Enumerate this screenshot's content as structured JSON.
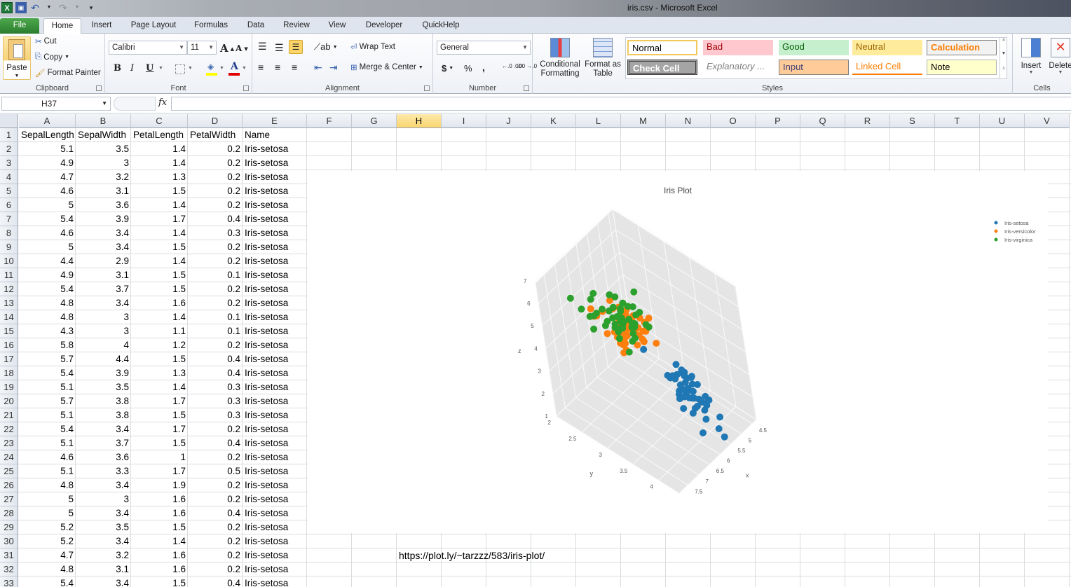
{
  "window": {
    "title": "iris.csv  -  Microsoft Excel"
  },
  "quick_access": {
    "icons": [
      "excel-logo-icon",
      "save-icon",
      "undo-icon",
      "redo-icon",
      "customize-qat-icon"
    ]
  },
  "tabs": [
    {
      "label": "File",
      "active": false
    },
    {
      "label": "Home",
      "active": true
    },
    {
      "label": "Insert",
      "active": false
    },
    {
      "label": "Page Layout",
      "active": false
    },
    {
      "label": "Formulas",
      "active": false
    },
    {
      "label": "Data",
      "active": false
    },
    {
      "label": "Review",
      "active": false
    },
    {
      "label": "View",
      "active": false
    },
    {
      "label": "Developer",
      "active": false
    },
    {
      "label": "QuickHelp",
      "active": false
    }
  ],
  "ribbon": {
    "clipboard": {
      "label": "Clipboard",
      "paste": "Paste",
      "cut": "Cut",
      "copy": "Copy",
      "format_painter": "Format Painter"
    },
    "font": {
      "label": "Font",
      "font_name": "Calibri",
      "font_size": "11",
      "bold": "B",
      "italic": "I",
      "underline": "U",
      "grow": "A",
      "shrink": "A",
      "font_color": "A",
      "fill_color": "#ffff00",
      "text_color": "#e00000"
    },
    "alignment": {
      "label": "Alignment",
      "wrap_text": "Wrap Text",
      "merge_center": "Merge & Center"
    },
    "number": {
      "label": "Number",
      "format": "General",
      "currency": "$",
      "percent": "%",
      "comma": ",",
      "inc_decimal": "←.0 .00",
      "dec_decimal": ".00 →.0"
    },
    "conditional_formatting": "Conditional Formatting",
    "format_as_table": "Format as Table",
    "styles": {
      "label": "Styles",
      "items": [
        {
          "label": "Normal",
          "bg": "#ffffff",
          "fg": "#000000"
        },
        {
          "label": "Bad",
          "bg": "#ffc7ce",
          "fg": "#9c0006"
        },
        {
          "label": "Good",
          "bg": "#c6efce",
          "fg": "#006100"
        },
        {
          "label": "Neutral",
          "bg": "#ffeb9c",
          "fg": "#9c6500"
        },
        {
          "label": "Calculation",
          "bg": "#f2f2f2",
          "fg": "#fa7d00"
        },
        {
          "label": "Check Cell",
          "bg": "#a5a5a5",
          "fg": "#ffffff"
        },
        {
          "label": "Explanatory ...",
          "bg": "#ffffff",
          "fg": "#7f7f7f"
        },
        {
          "label": "Input",
          "bg": "#ffcc99",
          "fg": "#3f3f76"
        },
        {
          "label": "Linked Cell",
          "bg": "#ffffff",
          "fg": "#fa7d00"
        },
        {
          "label": "Note",
          "bg": "#ffffcc",
          "fg": "#000000"
        }
      ]
    },
    "cells": {
      "label": "Cells",
      "insert": "Insert",
      "delete": "Delete"
    }
  },
  "formula_bar": {
    "name_box": "H37",
    "fx": "fx",
    "formula": ""
  },
  "columns": [
    "A",
    "B",
    "C",
    "D",
    "E",
    "F",
    "G",
    "H",
    "I",
    "J",
    "K",
    "L",
    "M",
    "N",
    "O",
    "P",
    "Q",
    "R",
    "S",
    "T",
    "U",
    "V"
  ],
  "selected_column": "H",
  "sheet": {
    "header": [
      "SepalLength",
      "SepalWidth",
      "PetalLength",
      "PetalWidth",
      "Name"
    ],
    "rows": [
      [
        "5.1",
        "3.5",
        "1.4",
        "0.2",
        "Iris-setosa"
      ],
      [
        "4.9",
        "3",
        "1.4",
        "0.2",
        "Iris-setosa"
      ],
      [
        "4.7",
        "3.2",
        "1.3",
        "0.2",
        "Iris-setosa"
      ],
      [
        "4.6",
        "3.1",
        "1.5",
        "0.2",
        "Iris-setosa"
      ],
      [
        "5",
        "3.6",
        "1.4",
        "0.2",
        "Iris-setosa"
      ],
      [
        "5.4",
        "3.9",
        "1.7",
        "0.4",
        "Iris-setosa"
      ],
      [
        "4.6",
        "3.4",
        "1.4",
        "0.3",
        "Iris-setosa"
      ],
      [
        "5",
        "3.4",
        "1.5",
        "0.2",
        "Iris-setosa"
      ],
      [
        "4.4",
        "2.9",
        "1.4",
        "0.2",
        "Iris-setosa"
      ],
      [
        "4.9",
        "3.1",
        "1.5",
        "0.1",
        "Iris-setosa"
      ],
      [
        "5.4",
        "3.7",
        "1.5",
        "0.2",
        "Iris-setosa"
      ],
      [
        "4.8",
        "3.4",
        "1.6",
        "0.2",
        "Iris-setosa"
      ],
      [
        "4.8",
        "3",
        "1.4",
        "0.1",
        "Iris-setosa"
      ],
      [
        "4.3",
        "3",
        "1.1",
        "0.1",
        "Iris-setosa"
      ],
      [
        "5.8",
        "4",
        "1.2",
        "0.2",
        "Iris-setosa"
      ],
      [
        "5.7",
        "4.4",
        "1.5",
        "0.4",
        "Iris-setosa"
      ],
      [
        "5.4",
        "3.9",
        "1.3",
        "0.4",
        "Iris-setosa"
      ],
      [
        "5.1",
        "3.5",
        "1.4",
        "0.3",
        "Iris-setosa"
      ],
      [
        "5.7",
        "3.8",
        "1.7",
        "0.3",
        "Iris-setosa"
      ],
      [
        "5.1",
        "3.8",
        "1.5",
        "0.3",
        "Iris-setosa"
      ],
      [
        "5.4",
        "3.4",
        "1.7",
        "0.2",
        "Iris-setosa"
      ],
      [
        "5.1",
        "3.7",
        "1.5",
        "0.4",
        "Iris-setosa"
      ],
      [
        "4.6",
        "3.6",
        "1",
        "0.2",
        "Iris-setosa"
      ],
      [
        "5.1",
        "3.3",
        "1.7",
        "0.5",
        "Iris-setosa"
      ],
      [
        "4.8",
        "3.4",
        "1.9",
        "0.2",
        "Iris-setosa"
      ],
      [
        "5",
        "3",
        "1.6",
        "0.2",
        "Iris-setosa"
      ],
      [
        "5",
        "3.4",
        "1.6",
        "0.4",
        "Iris-setosa"
      ],
      [
        "5.2",
        "3.5",
        "1.5",
        "0.2",
        "Iris-setosa"
      ],
      [
        "5.2",
        "3.4",
        "1.4",
        "0.2",
        "Iris-setosa"
      ],
      [
        "4.7",
        "3.2",
        "1.6",
        "0.2",
        "Iris-setosa"
      ],
      [
        "4.8",
        "3.1",
        "1.6",
        "0.2",
        "Iris-setosa"
      ],
      [
        "5.4",
        "3.4",
        "1.5",
        "0.4",
        "Iris-setosa"
      ]
    ],
    "url_cell": "https://plot.ly/~tarzzz/583/iris-plot/"
  },
  "chart_data": {
    "type": "scatter",
    "subtype": "scatter3d",
    "title": "Iris Plot",
    "xlabel": "x",
    "ylabel": "y",
    "zlabel": "z",
    "x_ticks": [
      "4.5",
      "5",
      "5.5",
      "6",
      "6.5",
      "7",
      "7.5"
    ],
    "y_ticks": [
      "2",
      "2.5",
      "3",
      "3.5",
      "4"
    ],
    "z_ticks": [
      "1",
      "2",
      "3",
      "4",
      "5",
      "6",
      "7"
    ],
    "xlim": [
      4.3,
      7.9
    ],
    "ylim": [
      2.0,
      4.4
    ],
    "zlim": [
      1.0,
      6.9
    ],
    "legend": "top-right",
    "series": [
      {
        "name": "Iris-setosa",
        "color": "#1f77b4",
        "points": [
          [
            5.1,
            3.5,
            1.4
          ],
          [
            4.9,
            3,
            1.4
          ],
          [
            4.7,
            3.2,
            1.3
          ],
          [
            4.6,
            3.1,
            1.5
          ],
          [
            5,
            3.6,
            1.4
          ],
          [
            5.4,
            3.9,
            1.7
          ],
          [
            4.6,
            3.4,
            1.4
          ],
          [
            5,
            3.4,
            1.5
          ],
          [
            4.4,
            2.9,
            1.4
          ],
          [
            4.9,
            3.1,
            1.5
          ],
          [
            5.4,
            3.7,
            1.5
          ],
          [
            4.8,
            3.4,
            1.6
          ],
          [
            4.8,
            3,
            1.4
          ],
          [
            4.3,
            3,
            1.1
          ],
          [
            5.8,
            4,
            1.2
          ],
          [
            5.7,
            4.4,
            1.5
          ],
          [
            5.4,
            3.9,
            1.3
          ],
          [
            5.1,
            3.5,
            1.4
          ],
          [
            5.7,
            3.8,
            1.7
          ],
          [
            5.1,
            3.8,
            1.5
          ],
          [
            5.4,
            3.4,
            1.7
          ],
          [
            5.1,
            3.7,
            1.5
          ],
          [
            4.6,
            3.6,
            1
          ],
          [
            5.1,
            3.3,
            1.7
          ],
          [
            4.8,
            3.4,
            1.9
          ],
          [
            5,
            3,
            1.6
          ],
          [
            5,
            3.4,
            1.6
          ],
          [
            5.2,
            3.5,
            1.5
          ],
          [
            5.2,
            3.4,
            1.4
          ],
          [
            4.7,
            3.2,
            1.6
          ],
          [
            4.8,
            3.1,
            1.6
          ],
          [
            5.4,
            3.4,
            1.5
          ],
          [
            5.2,
            4.1,
            1.5
          ],
          [
            5.5,
            4.2,
            1.4
          ],
          [
            4.9,
            3.1,
            1.5
          ],
          [
            5,
            3.2,
            1.2
          ],
          [
            5.5,
            3.5,
            1.3
          ],
          [
            4.4,
            3,
            1.3
          ],
          [
            5.1,
            3.4,
            1.5
          ],
          [
            5,
            3.5,
            1.3
          ],
          [
            4.5,
            2.3,
            1.3
          ],
          [
            4.4,
            3.2,
            1.3
          ],
          [
            5,
            3.5,
            1.6
          ],
          [
            5.1,
            3.8,
            1.9
          ],
          [
            4.8,
            3,
            1.4
          ],
          [
            5.1,
            3.8,
            1.6
          ],
          [
            4.6,
            3.2,
            1.4
          ],
          [
            5.3,
            3.7,
            1.5
          ],
          [
            5,
            3.3,
            1.4
          ]
        ]
      },
      {
        "name": "Iris-versicolor",
        "color": "#ff7f0e",
        "points": [
          [
            7,
            3.2,
            4.7
          ],
          [
            6.4,
            3.2,
            4.5
          ],
          [
            6.9,
            3.1,
            4.9
          ],
          [
            5.5,
            2.3,
            4
          ],
          [
            6.5,
            2.8,
            4.6
          ],
          [
            5.7,
            2.8,
            4.5
          ],
          [
            6.3,
            3.3,
            4.7
          ],
          [
            4.9,
            2.4,
            3.3
          ],
          [
            6.6,
            2.9,
            4.6
          ],
          [
            5.2,
            2.7,
            3.9
          ],
          [
            5,
            2,
            3.5
          ],
          [
            5.9,
            3,
            4.2
          ],
          [
            6,
            2.2,
            4
          ],
          [
            6.1,
            2.9,
            4.7
          ],
          [
            5.6,
            2.9,
            3.6
          ],
          [
            6.7,
            3.1,
            4.4
          ],
          [
            5.6,
            3,
            4.5
          ],
          [
            5.8,
            2.7,
            4.1
          ],
          [
            6.2,
            2.2,
            4.5
          ],
          [
            5.6,
            2.5,
            3.9
          ],
          [
            5.9,
            3.2,
            4.8
          ],
          [
            6.1,
            2.8,
            4
          ],
          [
            6.3,
            2.5,
            4.9
          ],
          [
            6.1,
            2.8,
            4.7
          ],
          [
            6.4,
            2.9,
            4.3
          ],
          [
            6.6,
            3,
            4.4
          ],
          [
            6.8,
            2.8,
            4.8
          ],
          [
            6.7,
            3,
            5
          ],
          [
            6,
            2.9,
            4.5
          ],
          [
            5.7,
            2.6,
            3.5
          ],
          [
            5.5,
            2.4,
            3.8
          ],
          [
            5.5,
            2.4,
            3.7
          ],
          [
            5.8,
            2.7,
            3.9
          ],
          [
            6,
            2.7,
            5.1
          ],
          [
            5.4,
            3,
            4.5
          ],
          [
            6,
            3.4,
            4.5
          ],
          [
            6.7,
            3.1,
            4.7
          ],
          [
            6.3,
            2.3,
            4.4
          ],
          [
            5.6,
            3,
            4.1
          ],
          [
            5.5,
            2.5,
            4
          ],
          [
            5.5,
            2.6,
            4.4
          ],
          [
            6.1,
            3,
            4.6
          ],
          [
            5.8,
            2.6,
            4
          ],
          [
            5,
            2.3,
            3.3
          ],
          [
            5.6,
            2.7,
            4.2
          ],
          [
            5.7,
            3,
            4.2
          ],
          [
            5.7,
            2.9,
            4.2
          ],
          [
            6.2,
            2.9,
            4.3
          ],
          [
            5.1,
            2.5,
            3
          ],
          [
            5.7,
            2.8,
            4.1
          ]
        ]
      },
      {
        "name": "Iris-virginica",
        "color": "#2ca02c",
        "points": [
          [
            6.3,
            3.3,
            6
          ],
          [
            5.8,
            2.7,
            5.1
          ],
          [
            7.1,
            3,
            5.9
          ],
          [
            6.3,
            2.9,
            5.6
          ],
          [
            6.5,
            3,
            5.8
          ],
          [
            7.6,
            3,
            6.6
          ],
          [
            4.9,
            2.5,
            4.5
          ],
          [
            7.3,
            2.9,
            6.3
          ],
          [
            6.7,
            2.5,
            5.8
          ],
          [
            7.2,
            3.6,
            6.1
          ],
          [
            6.5,
            3.2,
            5.1
          ],
          [
            6.4,
            2.7,
            5.3
          ],
          [
            6.8,
            3,
            5.5
          ],
          [
            5.7,
            2.5,
            5
          ],
          [
            5.8,
            2.8,
            5.1
          ],
          [
            6.4,
            3.2,
            5.3
          ],
          [
            6.5,
            3,
            5.5
          ],
          [
            7.7,
            3.8,
            6.7
          ],
          [
            7.7,
            2.6,
            6.9
          ],
          [
            6,
            2.2,
            5
          ],
          [
            6.9,
            3.2,
            5.7
          ],
          [
            5.6,
            2.8,
            4.9
          ],
          [
            7.7,
            2.8,
            6.7
          ],
          [
            6.3,
            2.7,
            4.9
          ],
          [
            6.7,
            3.3,
            5.7
          ],
          [
            7.2,
            3.2,
            6
          ],
          [
            6.2,
            2.8,
            4.8
          ],
          [
            6.1,
            3,
            4.9
          ],
          [
            6.4,
            2.8,
            5.6
          ],
          [
            7.2,
            3,
            5.8
          ],
          [
            7.4,
            2.8,
            6.1
          ],
          [
            7.9,
            3.8,
            6.4
          ],
          [
            6.4,
            2.8,
            5.6
          ],
          [
            6.3,
            2.8,
            5.1
          ],
          [
            6.1,
            2.6,
            5.6
          ],
          [
            7.7,
            3,
            6.1
          ],
          [
            6.3,
            3.4,
            5.6
          ],
          [
            6.4,
            3.1,
            5.5
          ],
          [
            6,
            3,
            4.8
          ],
          [
            6.9,
            3.1,
            5.4
          ],
          [
            6.7,
            3.1,
            5.6
          ],
          [
            6.9,
            3.1,
            5.1
          ],
          [
            5.8,
            2.7,
            5.1
          ],
          [
            6.8,
            3.2,
            5.9
          ],
          [
            6.7,
            3.3,
            5.7
          ],
          [
            6.7,
            3,
            5.2
          ],
          [
            6.3,
            2.5,
            5
          ],
          [
            6.5,
            3,
            5.2
          ],
          [
            6.2,
            3.4,
            5.4
          ],
          [
            5.9,
            3,
            5.1
          ]
        ]
      }
    ]
  }
}
